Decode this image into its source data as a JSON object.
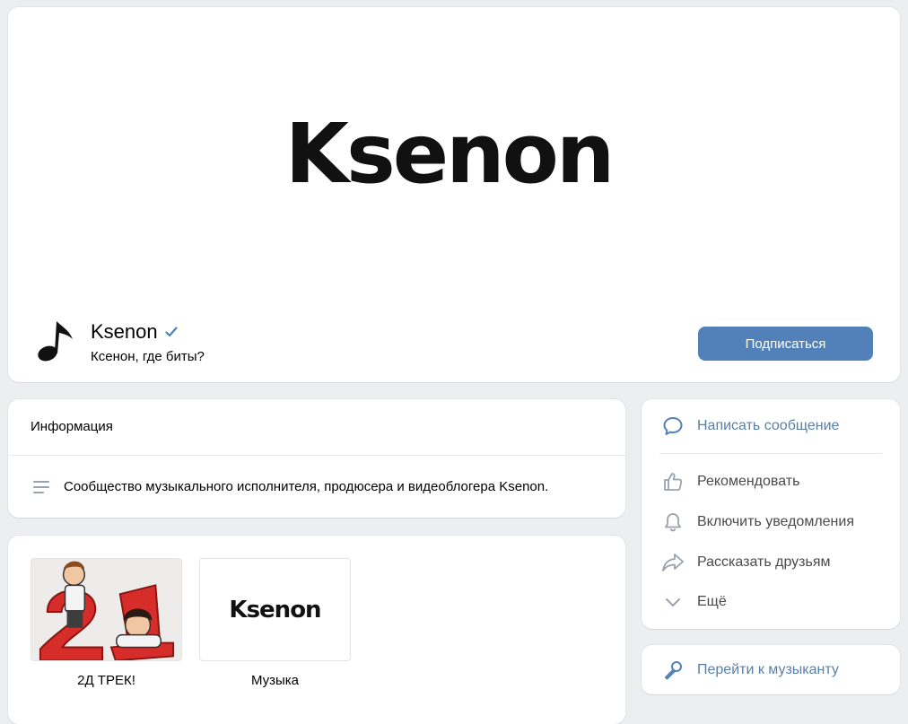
{
  "header": {
    "cover_logo": "Ksenon",
    "group_name": "Ksenon",
    "status": "Ксенон, где биты?",
    "subscribe_label": "Подписаться",
    "accent_color": "#5181b8"
  },
  "info": {
    "title": "Информация",
    "description": "Сообщество музыкального исполнителя, продюсера и видеоблогера Ksenon."
  },
  "links": [
    {
      "caption": "2Д ТРЕК!",
      "icon": "cartoon-thumbnail"
    },
    {
      "caption": "Музыка",
      "thumb_text": "Ksenon"
    }
  ],
  "actions": {
    "message": "Написать сообщение",
    "recommend": "Рекомендовать",
    "notifications": "Включить уведомления",
    "share": "Рассказать друзьям",
    "more": "Ещё"
  },
  "musician": {
    "label": "Перейти к музыканту"
  }
}
